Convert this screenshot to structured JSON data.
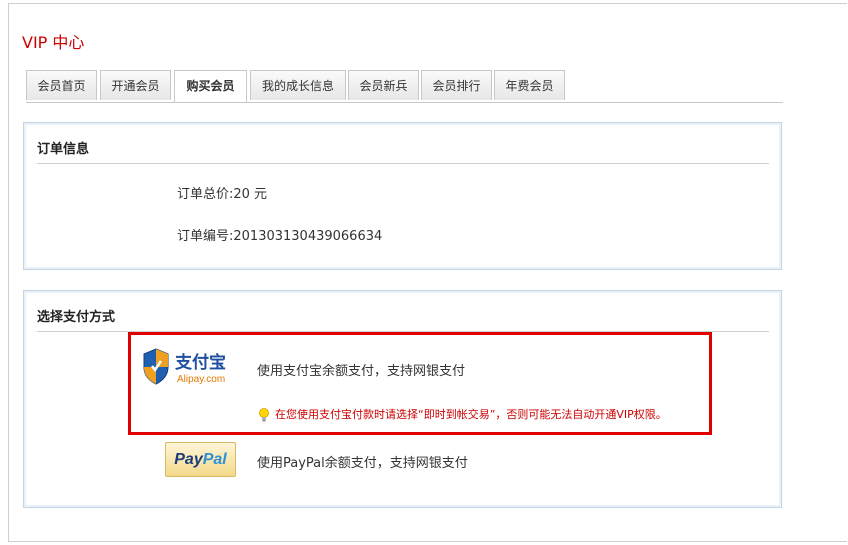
{
  "page": {
    "title": "VIP 中心"
  },
  "tabs": [
    {
      "label": "会员首页",
      "active": false
    },
    {
      "label": "开通会员",
      "active": false
    },
    {
      "label": "购买会员",
      "active": true
    },
    {
      "label": "我的成长信息",
      "active": false
    },
    {
      "label": "会员新兵",
      "active": false
    },
    {
      "label": "会员排行",
      "active": false
    },
    {
      "label": "年费会员",
      "active": false
    }
  ],
  "order": {
    "title": "订单信息",
    "total_line": "订单总价:20 元",
    "number_line": "订单编号:201303130439066634"
  },
  "payment": {
    "title": "选择支付方式",
    "alipay": {
      "logo_text": "支付宝",
      "logo_subtext": "Alipay.com",
      "description": "使用支付宝余额支付，支持网银支付",
      "warning": "在您使用支付宝付款时请选择“即时到帐交易”，否则可能无法自动开通VIP权限。"
    },
    "paypal": {
      "logo_part1": "Pay",
      "logo_part2": "Pal",
      "description": "使用PayPal余额支付，支持网银支付"
    }
  },
  "colors": {
    "title_red": "#cc0000",
    "highlight_red": "#e00000",
    "panel_border": "#c6d5e3"
  },
  "icons": {
    "shield": "alipay-shield-icon",
    "warning": "lightbulb-icon"
  }
}
